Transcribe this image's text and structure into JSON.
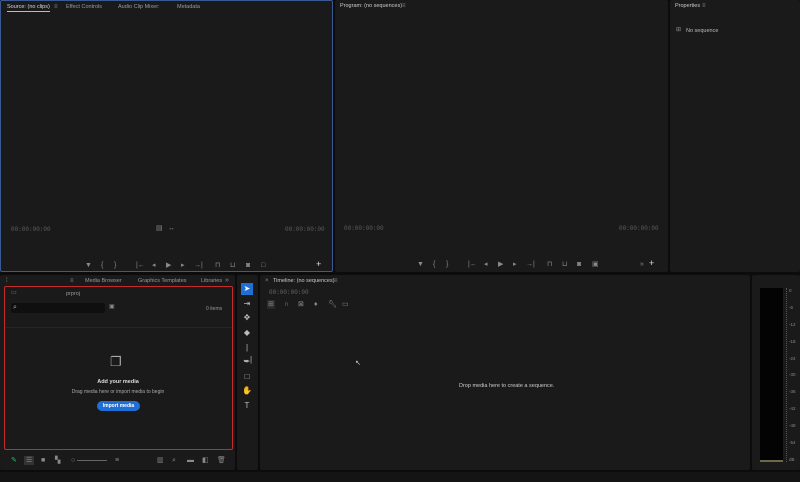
{
  "source_panel": {
    "tabs": [
      "Source: (no clips)",
      "Effect Controls",
      "Audio Clip Mixer:",
      "Metadata"
    ],
    "timecode_left": "00:00:00:00",
    "timecode_right": "00:00:00:00"
  },
  "program_panel": {
    "title": "Program: (no sequences)",
    "timecode_left": "00:00:00:00",
    "timecode_right": "00:00:00:00"
  },
  "properties_panel": {
    "title": "Properties",
    "status": "No sequence"
  },
  "project_panel": {
    "tabs": [
      "Media Browser",
      "Graphics Templates",
      "Libraries"
    ],
    "project_name": "prproj",
    "search_placeholder": "",
    "item_count": "0 items",
    "empty_title": "Add your media",
    "empty_text": "Drag media here or import media to begin",
    "import_button": "Import media",
    "highlight_color": "#c8292c"
  },
  "timeline_panel": {
    "title": "Timeline: (no sequences)",
    "timecode": "00:00:00:00",
    "empty_text": "Drop media here to create a sequence."
  },
  "audio_meter": {
    "scale": [
      "0",
      "-6",
      "-12",
      "-18",
      "-24",
      "-30",
      "-36",
      "-42",
      "-48",
      "-54",
      "dB"
    ]
  },
  "colors": {
    "accent": "#1f6fd6",
    "source_border": "#3a5a95"
  }
}
